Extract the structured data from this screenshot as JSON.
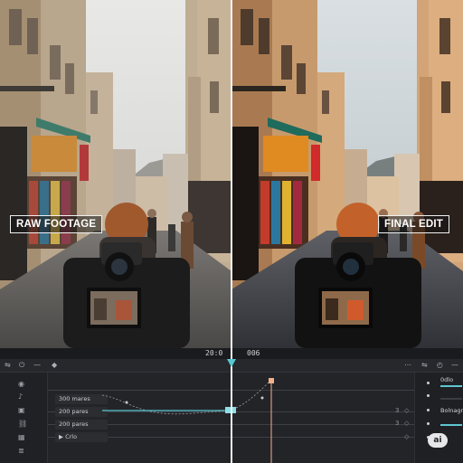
{
  "preview": {
    "left_label": "RAW FOOTAGE",
    "right_label": "FINAL EDIT"
  },
  "timeline": {
    "timecode_left": "20:0",
    "timecode_right": "006",
    "tracks": [
      {
        "label": "300 mares"
      },
      {
        "label": "200 pares"
      },
      {
        "label": "200 pares"
      },
      {
        "label": "Crlo"
      }
    ],
    "track_end_values": [
      "3",
      "3"
    ]
  },
  "right_panel": {
    "header": "0dlo",
    "item_label": "Bolnagre"
  },
  "badge": {
    "label": "ai"
  },
  "colors": {
    "accent": "#59c7d1",
    "keyframe": "#f3b08a"
  }
}
